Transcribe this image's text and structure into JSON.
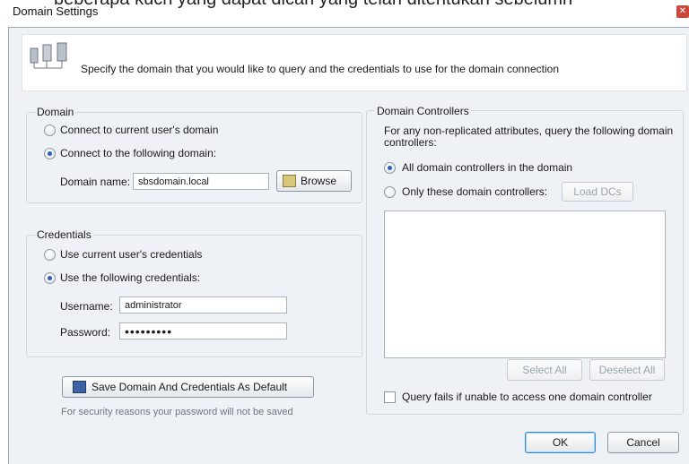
{
  "overlay_caption": "beberapa kuch yang dapat dicari yang telah ditentukan sebelumn",
  "window": {
    "title": "Domain Settings",
    "close_glyph": "✕"
  },
  "header": {
    "text": "Specify the domain that you would like to query and the credentials to use for the domain connection",
    "icon": "server-network-icon"
  },
  "domain": {
    "title": "Domain",
    "option_current": "Connect to current user's domain",
    "option_following": "Connect to the following domain:",
    "selected": "following",
    "name_label": "Domain name:",
    "name_value": "sbsdomain.local",
    "browse_label": "Browse"
  },
  "credentials": {
    "title": "Credentials",
    "option_current": "Use current user's credentials",
    "option_following": "Use the following credentials:",
    "selected": "following",
    "username_label": "Username:",
    "username_value": "administrator",
    "password_label": "Password:",
    "password_value": "•••••••••"
  },
  "save_button": "Save Domain And Credentials As Default",
  "security_note": "For security reasons your password will not be saved",
  "domain_controllers": {
    "title": "Domain Controllers",
    "description": "For any non-replicated attributes, query the following domain controllers:",
    "option_all": "All domain controllers in the domain",
    "option_only": "Only these domain controllers:",
    "selected": "all",
    "load_dcs": "Load DCs",
    "select_all": "Select All",
    "deselect_all": "Deselect All",
    "query_fails": "Query fails if unable to access one domain controller",
    "query_fails_checked": false
  },
  "ok": "OK",
  "cancel": "Cancel",
  "colors": {
    "accent": "#2a5fb5",
    "background": "#eef1f5"
  }
}
